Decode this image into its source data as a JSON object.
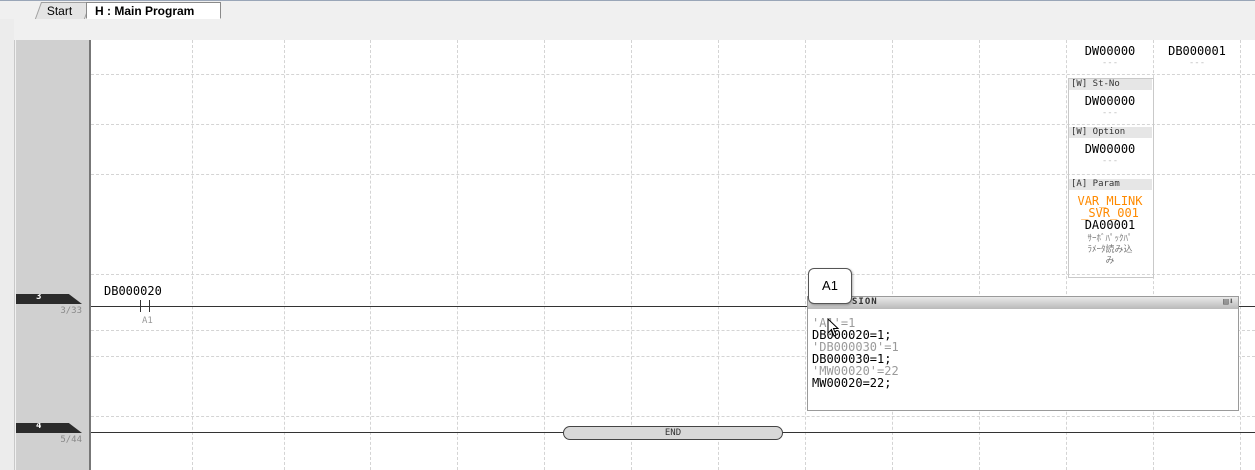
{
  "tabs": {
    "start": "Start",
    "main": "H : Main Program"
  },
  "function_block": {
    "top_left": "DW00000",
    "top_left_dash": "---",
    "top_right": "DB000001",
    "top_right_dash": "---",
    "st_no_label": "[W] St-No",
    "st_no_value": "DW00000",
    "st_no_dash": "---",
    "option_label": "[W] Option",
    "option_value": "DW00000",
    "option_dash": "---",
    "param_label": "[A] Param",
    "param_var_line1": "VAR_MLINK",
    "param_var_line2": "_SVR_001",
    "param_value": "DA00001",
    "param_note_line1": "ｻｰﾎﾞﾊﾟｯｸﾊﾟ",
    "param_note_line2": "ﾗﾒｰﾀ読み込",
    "param_note_line3": "み"
  },
  "rungs": [
    {
      "number": "3",
      "count": "3/33",
      "contact_label": "DB000020",
      "contact_comment": "A1"
    },
    {
      "number": "4",
      "count": "5/44",
      "end_label": "END"
    }
  ],
  "expression_panel": {
    "title": "SION",
    "icons": "▤⬇",
    "lines": [
      {
        "text": "'A1'=1",
        "kind": "comment"
      },
      {
        "text": "DB000020=1;",
        "kind": "code"
      },
      {
        "text": "'DB000030'=1",
        "kind": "comment"
      },
      {
        "text": "DB000030=1;",
        "kind": "code"
      },
      {
        "text": "'MW00020'=22",
        "kind": "comment"
      },
      {
        "text": "MW00020=22;",
        "kind": "code"
      }
    ]
  },
  "tooltip": {
    "text": "A1"
  }
}
